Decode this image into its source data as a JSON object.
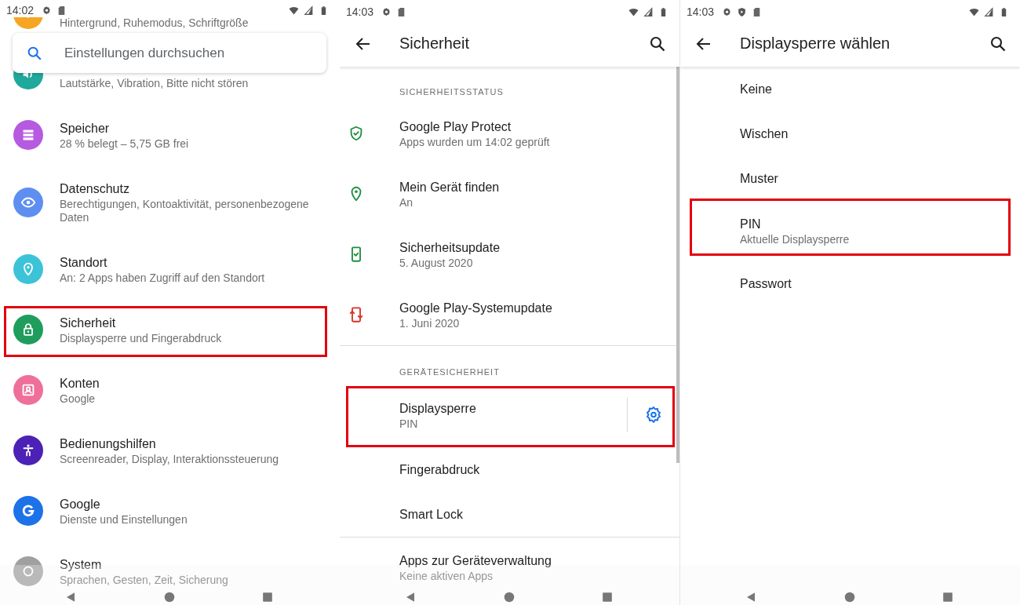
{
  "panels": [
    {
      "kind": "settings_home",
      "status_bar": {
        "time": "14:02"
      },
      "search": {
        "placeholder": "Einstellungen durchsuchen"
      },
      "items": [
        {
          "subtitle": "Hintergrund, Ruhemodus, Schriftgröße",
          "color": "#f6a623",
          "highlighted": false
        },
        {
          "subtitle": "Lautstärke, Vibration, Bitte nicht stören",
          "color": "#1ea99c",
          "highlighted": false
        },
        {
          "title": "Speicher",
          "subtitle": "28 % belegt – 5,75 GB frei",
          "color": "#b65ae0",
          "highlighted": false
        },
        {
          "title": "Datenschutz",
          "subtitle": "Berechtigungen, Kontoaktivität, personenbezogene Daten",
          "color": "#5e8ff0",
          "highlighted": false
        },
        {
          "title": "Standort",
          "subtitle": "An: 2 Apps haben Zugriff auf den Standort",
          "color": "#3cc3d8",
          "highlighted": false
        },
        {
          "title": "Sicherheit",
          "subtitle": "Displaysperre und Fingerabdruck",
          "color": "#1f9d5c",
          "highlighted": true
        },
        {
          "title": "Konten",
          "subtitle": "Google",
          "color": "#ee6f9a",
          "highlighted": false
        },
        {
          "title": "Bedienungshilfen",
          "subtitle": "Screenreader, Display, Interaktionssteuerung",
          "color": "#4b21b6",
          "highlighted": false
        },
        {
          "title": "Google",
          "subtitle": "Dienste und Einstellungen",
          "color": "#1d72e8",
          "highlighted": false
        },
        {
          "title": "System",
          "subtitle": "Sprachen, Gesten, Zeit, Sicherung",
          "color": "#a0a0a0",
          "highlighted": false
        }
      ]
    },
    {
      "kind": "security",
      "status_bar": {
        "time": "14:03"
      },
      "header": {
        "title": "Sicherheit"
      },
      "sections": [
        {
          "heading": "SICHERHEITSSTATUS",
          "items": [
            {
              "title": "Google Play Protect",
              "subtitle": "Apps wurden um 14:02 geprüft",
              "color": "#1e8e3e",
              "highlighted": false
            },
            {
              "title": "Mein Gerät finden",
              "subtitle": "An",
              "color": "#1e8e3e",
              "highlighted": false
            },
            {
              "title": "Sicherheitsupdate",
              "subtitle": "5. August 2020",
              "color": "#1e8e3e",
              "highlighted": false
            },
            {
              "title": "Google Play-Systemupdate",
              "subtitle": "1. Juni 2020",
              "color": "#d93025",
              "highlighted": false
            }
          ]
        },
        {
          "heading": "GERÄTESICHERHEIT",
          "items": [
            {
              "title": "Displaysperre",
              "subtitle": "PIN",
              "highlighted": true,
              "settings_button": true
            },
            {
              "title": "Fingerabdruck",
              "highlighted": false
            },
            {
              "title": "Smart Lock",
              "highlighted": false
            }
          ]
        },
        {
          "items": [
            {
              "title": "Apps zur Geräteverwaltung",
              "subtitle": "Keine aktiven Apps",
              "highlighted": false
            }
          ]
        }
      ]
    },
    {
      "kind": "lock_choice",
      "status_bar": {
        "time": "14:03"
      },
      "header": {
        "title": "Displaysperre wählen"
      },
      "items": [
        {
          "title": "Keine",
          "highlighted": false
        },
        {
          "title": "Wischen",
          "highlighted": false
        },
        {
          "title": "Muster",
          "highlighted": false
        },
        {
          "title": "PIN",
          "subtitle": "Aktuelle Displaysperre",
          "highlighted": true
        },
        {
          "title": "Passwort",
          "highlighted": false
        }
      ]
    }
  ]
}
